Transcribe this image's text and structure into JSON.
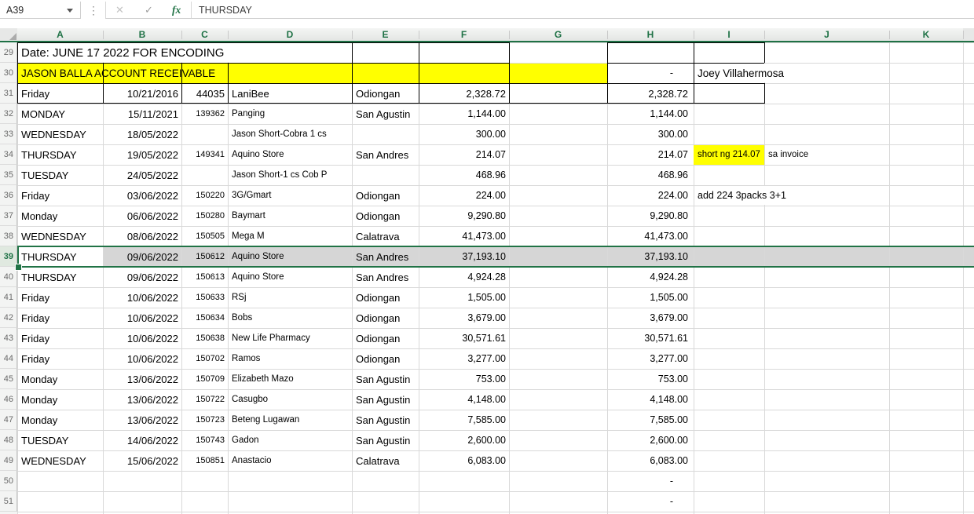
{
  "name_box": "A39",
  "formula_bar": "THURSDAY",
  "icons": {
    "cancel": "✕",
    "enter": "✓",
    "function_label": "fx",
    "drag_dots": "⋮"
  },
  "column_headers": [
    "A",
    "B",
    "C",
    "D",
    "E",
    "F",
    "G",
    "H",
    "I",
    "J",
    "K"
  ],
  "selection": {
    "active_cell": "A39",
    "selected_row": 39
  },
  "colors": {
    "header_green": "#1E7145",
    "selection_border": "#217346",
    "selection_fill": "#D6D6D6",
    "highlight_yellow": "#FFFF00",
    "gridline": "#D9D9D9",
    "border_black": "#000000"
  },
  "rows": [
    {
      "n": 29,
      "cells": {
        "A": "Date: JUNE 17 2022 FOR ENCODING"
      }
    },
    {
      "n": 30,
      "fill": {
        "range": "A:G",
        "color": "#FFFF00"
      },
      "cells": {
        "A": "JASON BALLA ACCOUNT RECEIVABLE",
        "H": "-",
        "I": "Joey Villahermosa"
      }
    },
    {
      "n": 31,
      "cells": {
        "A": "Friday",
        "B": "10/21/2016",
        "C": "44035",
        "D": "LaniBee",
        "E": "Odiongan",
        "F": "2,328.72",
        "H": "2,328.72"
      }
    },
    {
      "n": 32,
      "cells": {
        "A": "MONDAY",
        "B": "15/11/2021",
        "C": "139362",
        "D": "Panging",
        "E": "San Agustin",
        "F": "1,144.00",
        "H": "1,144.00"
      }
    },
    {
      "n": 33,
      "cells": {
        "A": "WEDNESDAY",
        "B": "18/05/2022",
        "D": "Jason Short-Cobra 1 cs",
        "F": "300.00",
        "H": "300.00"
      }
    },
    {
      "n": 34,
      "fill": {
        "range": "I:I",
        "color": "#FFFF00"
      },
      "cells": {
        "A": "THURSDAY",
        "B": "19/05/2022",
        "C": "149341",
        "D": "Aquino Store",
        "E": "San Andres",
        "F": "214.07",
        "H": "214.07",
        "I": "short ng 214.07",
        "J": "sa invoice"
      }
    },
    {
      "n": 35,
      "cells": {
        "A": "TUESDAY",
        "B": "24/05/2022",
        "D": "Jason Short-1 cs Cob P",
        "F": "468.96",
        "H": "468.96"
      }
    },
    {
      "n": 36,
      "cells": {
        "A": "Friday",
        "B": "03/06/2022",
        "C": "150220",
        "D": "3G/Gmart",
        "E": "Odiongan",
        "F": "224.00",
        "H": "224.00",
        "I": "add 224 3packs 3+1"
      }
    },
    {
      "n": 37,
      "cells": {
        "A": "Monday",
        "B": "06/06/2022",
        "C": "150280",
        "D": "Baymart",
        "E": "Odiongan",
        "F": "9,290.80",
        "H": "9,290.80"
      }
    },
    {
      "n": 38,
      "cells": {
        "A": "WEDNESDAY",
        "B": "08/06/2022",
        "C": "150505",
        "D": "Mega M",
        "E": "Calatrava",
        "F": "41,473.00",
        "H": "41,473.00"
      }
    },
    {
      "n": 39,
      "cells": {
        "A": "THURSDAY",
        "B": "09/06/2022",
        "C": "150612",
        "D": "Aquino Store",
        "E": "San Andres",
        "F": "37,193.10",
        "H": "37,193.10"
      }
    },
    {
      "n": 40,
      "cells": {
        "A": "THURSDAY",
        "B": "09/06/2022",
        "C": "150613",
        "D": "Aquino Store",
        "E": "San Andres",
        "F": "4,924.28",
        "H": "4,924.28"
      }
    },
    {
      "n": 41,
      "cells": {
        "A": "Friday",
        "B": "10/06/2022",
        "C": "150633",
        "D": "RSj",
        "E": "Odiongan",
        "F": "1,505.00",
        "H": "1,505.00"
      }
    },
    {
      "n": 42,
      "cells": {
        "A": "Friday",
        "B": "10/06/2022",
        "C": "150634",
        "D": "Bobs",
        "E": "Odiongan",
        "F": "3,679.00",
        "H": "3,679.00"
      }
    },
    {
      "n": 43,
      "cells": {
        "A": "Friday",
        "B": "10/06/2022",
        "C": "150638",
        "D": "New Life Pharmacy",
        "E": "Odiongan",
        "F": "30,571.61",
        "H": "30,571.61"
      }
    },
    {
      "n": 44,
      "cells": {
        "A": "Friday",
        "B": "10/06/2022",
        "C": "150702",
        "D": "Ramos",
        "E": "Odiongan",
        "F": "3,277.00",
        "H": "3,277.00"
      }
    },
    {
      "n": 45,
      "cells": {
        "A": "Monday",
        "B": "13/06/2022",
        "C": "150709",
        "D": "Elizabeth Mazo",
        "E": "San Agustin",
        "F": "753.00",
        "H": "753.00"
      }
    },
    {
      "n": 46,
      "cells": {
        "A": "Monday",
        "B": "13/06/2022",
        "C": "150722",
        "D": "Casugbo",
        "E": "San Agustin",
        "F": "4,148.00",
        "H": "4,148.00"
      }
    },
    {
      "n": 47,
      "cells": {
        "A": "Monday",
        "B": "13/06/2022",
        "C": "150723",
        "D": "Beteng Lugawan",
        "E": "San Agustin",
        "F": "7,585.00",
        "H": "7,585.00"
      }
    },
    {
      "n": 48,
      "cells": {
        "A": "TUESDAY",
        "B": "14/06/2022",
        "C": "150743",
        "D": "Gadon",
        "E": "San Agustin",
        "F": "2,600.00",
        "H": "2,600.00"
      }
    },
    {
      "n": 49,
      "cells": {
        "A": "WEDNESDAY",
        "B": "15/06/2022",
        "C": "150851",
        "D": "Anastacio",
        "E": "Calatrava",
        "F": "6,083.00",
        "H": "6,083.00"
      }
    },
    {
      "n": 50,
      "cells": {
        "H": "-"
      }
    },
    {
      "n": 51,
      "cells": {
        "H": "-"
      }
    }
  ]
}
